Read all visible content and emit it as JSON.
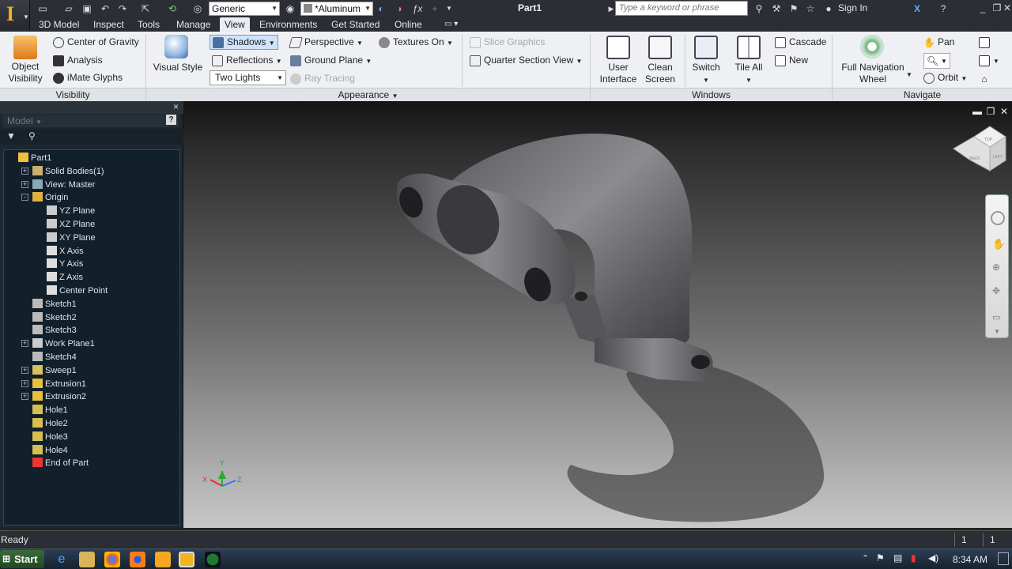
{
  "titlebar": {
    "app_logo": "I",
    "style_value": "Generic",
    "material_value": "*Aluminum",
    "doc_title": "Part1",
    "search_placeholder": "Type a keyword or phrase",
    "sign_in": "Sign In"
  },
  "tabs": [
    "3D Model",
    "Inspect",
    "Tools",
    "Manage",
    "View",
    "Environments",
    "Get Started",
    "Online"
  ],
  "active_tab": "View",
  "ribbon": {
    "visibility": {
      "label": "Visibility",
      "object_visibility": "Object Visibility",
      "center_of_gravity": "Center of Gravity",
      "analysis": "Analysis",
      "imate_glyphs": "iMate Glyphs"
    },
    "appearance": {
      "label": "Appearance",
      "visual_style": "Visual Style",
      "shadows": "Shadows",
      "reflections": "Reflections",
      "lighting_value": "Two Lights",
      "perspective": "Perspective",
      "ground_plane": "Ground Plane",
      "ray_tracing": "Ray Tracing",
      "textures_on": "Textures On",
      "slice_graphics": "Slice Graphics",
      "quarter_section_view": "Quarter Section View"
    },
    "windows": {
      "label": "Windows",
      "user_interface": "User Interface",
      "clean_screen": "Clean Screen",
      "switch": "Switch",
      "tile_all": "Tile All",
      "cascade": "Cascade",
      "new": "New"
    },
    "navigate": {
      "label": "Navigate",
      "full_navigation_wheel": "Full Navigation Wheel",
      "pan": "Pan",
      "orbit": "Orbit"
    }
  },
  "browser": {
    "dropdown": "Model",
    "tree": [
      {
        "label": "Part1",
        "expander": ""
      },
      {
        "label": "Solid Bodies(1)",
        "expander": "+"
      },
      {
        "label": "View: Master",
        "expander": "+"
      },
      {
        "label": "Origin",
        "expander": "-"
      },
      {
        "label": "YZ Plane",
        "expander": ""
      },
      {
        "label": "XZ Plane",
        "expander": ""
      },
      {
        "label": "XY Plane",
        "expander": ""
      },
      {
        "label": "X Axis",
        "expander": ""
      },
      {
        "label": "Y Axis",
        "expander": ""
      },
      {
        "label": "Z Axis",
        "expander": ""
      },
      {
        "label": "Center Point",
        "expander": ""
      },
      {
        "label": "Sketch1",
        "expander": ""
      },
      {
        "label": "Sketch2",
        "expander": ""
      },
      {
        "label": "Sketch3",
        "expander": ""
      },
      {
        "label": "Work Plane1",
        "expander": "+"
      },
      {
        "label": "Sketch4",
        "expander": ""
      },
      {
        "label": "Sweep1",
        "expander": "+"
      },
      {
        "label": "Extrusion1",
        "expander": "+"
      },
      {
        "label": "Extrusion2",
        "expander": "+"
      },
      {
        "label": "Hole1",
        "expander": ""
      },
      {
        "label": "Hole2",
        "expander": ""
      },
      {
        "label": "Hole3",
        "expander": ""
      },
      {
        "label": "Hole4",
        "expander": ""
      },
      {
        "label": "End of Part",
        "expander": ""
      }
    ]
  },
  "viewcube": {
    "face_top": "TOP",
    "face_front": "BACK",
    "face_side": "LEFT"
  },
  "triad": {
    "x": "X",
    "y": "Y",
    "z": "Z"
  },
  "status": {
    "text": "Ready",
    "count1": "1",
    "count2": "1"
  },
  "taskbar": {
    "start": "Start",
    "clock": "8:34 AM"
  }
}
